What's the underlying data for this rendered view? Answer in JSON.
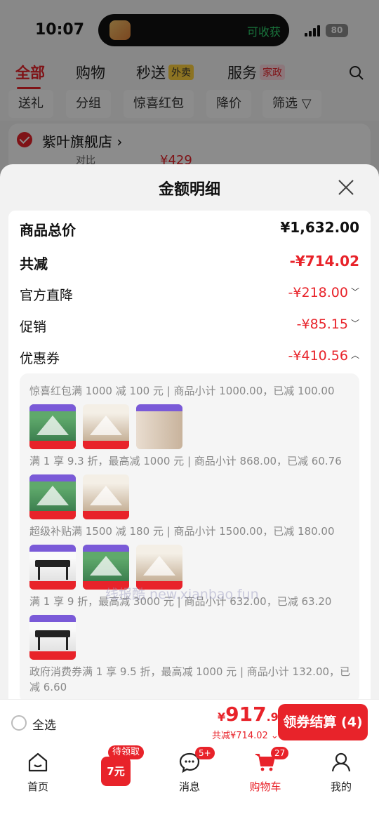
{
  "status": {
    "time": "10:07",
    "island_text": "可收获",
    "battery": "80"
  },
  "tabs": [
    {
      "label": "全部"
    },
    {
      "label": "购物"
    },
    {
      "label": "秒送",
      "tag": "外卖"
    },
    {
      "label": "服务",
      "tag": "家政"
    }
  ],
  "filters": [
    "送礼",
    "分组",
    "惊喜红包",
    "降价",
    "筛选"
  ],
  "store": {
    "name": "紫叶旗舰店",
    "sub": "对比",
    "price": "¥429"
  },
  "sheet": {
    "title": "金额明细",
    "rows": [
      {
        "label": "商品总价",
        "value": "¥1,632.00"
      },
      {
        "label": "共减",
        "value": "-¥714.02"
      },
      {
        "label": "官方直降",
        "value": "-¥218.00"
      },
      {
        "label": "促销",
        "value": "-¥85.15"
      },
      {
        "label": "优惠券",
        "value": "-¥410.56"
      }
    ],
    "coupons": [
      "惊喜红包满 1000 减 100 元 | 商品小计 1000.00，已减 100.00",
      "满 1 享 9.3 折，最高减 1000 元 | 商品小计 868.00，已减 60.76",
      "超级补贴满 1500 减 180 元 | 商品小计 1500.00，已减 180.00",
      "满 1 享 9 折，最高减 3000 元 | 商品小计 632.00，已减 63.20",
      "政府消费券满 1 享 9.5 折，最高减 1000 元 | 商品小计 132.00，已减 6.60"
    ],
    "watermark": "线报酷 new.xianbao.fun"
  },
  "bottom": {
    "select_all": "全选",
    "price_symbol": "¥",
    "price_int": "917",
    "price_dec": ".98",
    "reduced": "共减¥714.02",
    "checkout": "领券结算 (4)"
  },
  "nav": {
    "home": "首页",
    "promo_tag": "待领取",
    "promo_value": "7元",
    "messages": "消息",
    "messages_badge": "5+",
    "cart": "购物车",
    "cart_badge": "27",
    "mine": "我的"
  },
  "colors": {
    "accent": "#e8232a"
  }
}
